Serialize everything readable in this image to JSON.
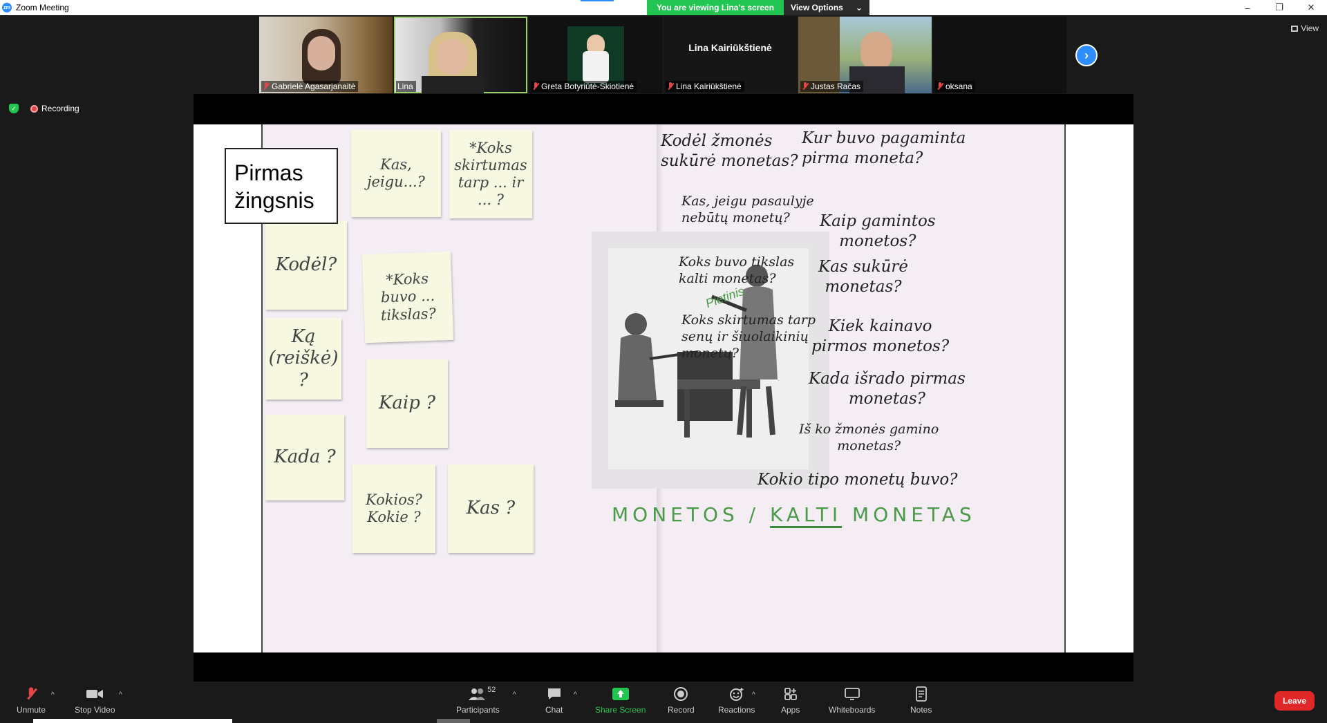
{
  "window": {
    "title": "Zoom Meeting",
    "logo": "zm",
    "minimize": "–",
    "restore": "❐",
    "close": "✕"
  },
  "banner": {
    "viewing": "You are viewing Lina's screen",
    "view_options": "View Options",
    "caret": "⌄"
  },
  "gallery": {
    "participants": [
      {
        "name": "Gabrielė Agasarjanaitė",
        "muted": true
      },
      {
        "name": "Lina",
        "muted": false
      },
      {
        "name": "Greta Botyriūtė-Skiotienė",
        "muted": true
      },
      {
        "name": "Lina Kairiūkštienė",
        "muted": true,
        "big_name": "Lina Kairiūkštienė"
      },
      {
        "name": "Justas Račas",
        "muted": true
      },
      {
        "name": "oksana",
        "muted": true
      }
    ],
    "next": "›",
    "view": "View"
  },
  "status": {
    "recording": "Recording",
    "shield": "✓"
  },
  "slide": {
    "step_box": "Pirmas\nžingsnis",
    "notes": {
      "kas_jeigu": "Kas, jeigu...?",
      "koks_skirtumas": "*Koks skirtumas tarp ... ir ... ?",
      "kodel": "Kodėl?",
      "koks_buvo": "*Koks buvo ... tikslas?",
      "ka_reiske": "Ką (reiškė) ?",
      "kaip": "Kaip ?",
      "kada": "Kada ?",
      "kokios": "Kokios? Kokie ?",
      "kas": "Kas ?"
    },
    "hw": {
      "kodel_zmones": "Kodėl žmonės\nsukūrė monetas?",
      "kur_buvo": "Kur buvo pagaminta\npirma moneta?",
      "kas_jeigu_pasaulyje": "Kas, jeigu pasaulyje\nnebūtų monetų?",
      "kaip_gamintos": "Kaip gamintos\nmonetos?",
      "koks_tikslas": "Koks buvo tikslas\nkalti monetas?",
      "kas_sukure": "Kas sukūrė\nmonetas?",
      "koks_skirtumas_senu": "Koks skirtumas tarp\nsenų ir šiuolaikinių\nmonetų?",
      "kiek_kainavo": "Kiek kainavo\npirmos monetos?",
      "kada_isrado": "Kada išrado pirmas\nmonetas?",
      "is_ko": "Iš ko žmonės gamino\nmonetas?",
      "kokio_tipo": "Kokio tipo monetų buvo?"
    },
    "monetos": "MONETOS /",
    "kalti": "KALTI",
    "monetas": "MONETAS",
    "pietinis": "Pietinis"
  },
  "toolbar": {
    "unmute": "Unmute",
    "stop_video": "Stop Video",
    "participants": "Participants",
    "participants_count": "52",
    "chat": "Chat",
    "share_screen": "Share Screen",
    "record": "Record",
    "reactions": "Reactions",
    "apps": "Apps",
    "whiteboards": "Whiteboards",
    "notes": "Notes",
    "leave": "Leave",
    "caret": "^"
  },
  "colors": {
    "accent": "#2d8cff",
    "green": "#23c552",
    "leave": "#e02828"
  }
}
